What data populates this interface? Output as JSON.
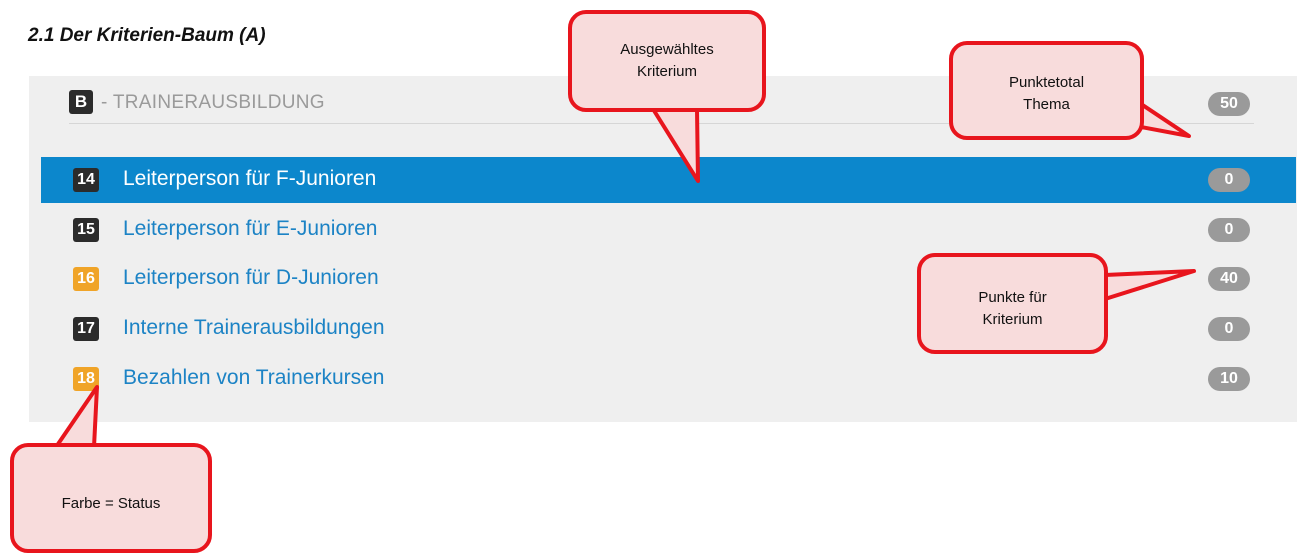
{
  "section_heading": "2.1 Der Kriterien-Baum (A)",
  "topic": {
    "badge": "B",
    "title": "- TRAINERAUSBILDUNG",
    "points": "50"
  },
  "criteria": [
    {
      "number": "14",
      "label": "Leiterperson für F-Junioren",
      "points": "0",
      "badge_color": "#2b2b2b",
      "selected": true
    },
    {
      "number": "15",
      "label": "Leiterperson für E-Junioren",
      "points": "0",
      "badge_color": "#2b2b2b",
      "selected": false
    },
    {
      "number": "16",
      "label": "Leiterperson für D-Junioren",
      "points": "40",
      "badge_color": "#f0a428",
      "selected": false
    },
    {
      "number": "17",
      "label": "Interne Trainerausbildungen",
      "points": "0",
      "badge_color": "#2b2b2b",
      "selected": false
    },
    {
      "number": "18",
      "label": "Bezahlen von Trainerkursen",
      "points": "10",
      "badge_color": "#f0a428",
      "selected": false
    }
  ],
  "callouts": {
    "selected": {
      "line1": "Ausgewähltes",
      "line2": "Kriterium"
    },
    "topic_total": {
      "line1": "Punktetotal",
      "line2": "Thema"
    },
    "criterion_points": {
      "line1": "Punkte für",
      "line2": "Kriterium"
    },
    "status": {
      "text": "Farbe = Status"
    }
  },
  "colors": {
    "selected_row": "#0c87cc",
    "link_text": "#1c83c5",
    "status_orange": "#f0a428",
    "status_dark": "#2b2b2b",
    "callout_border": "#e8151d",
    "callout_fill": "#f8dcdc"
  }
}
